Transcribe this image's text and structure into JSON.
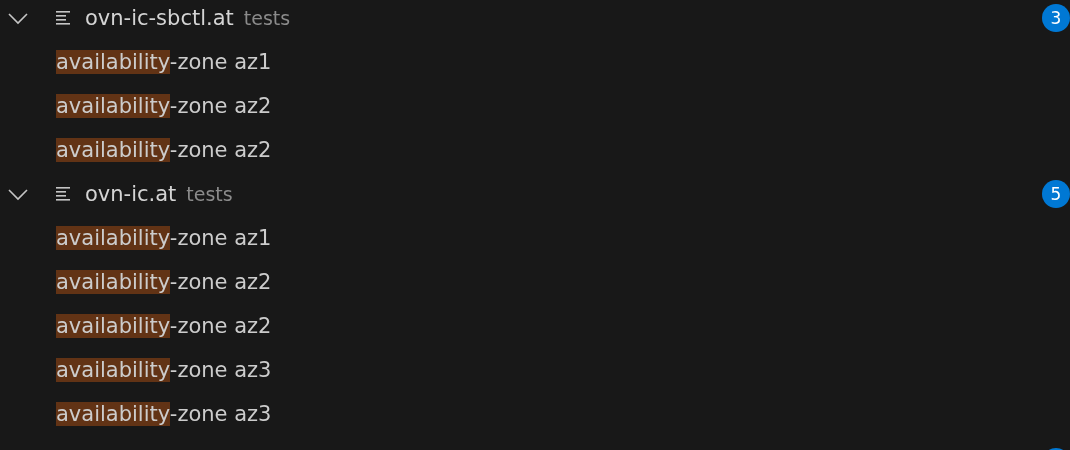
{
  "files": [
    {
      "kind": "file",
      "name": "ovn-ic-sbctl.at",
      "folder": "tests",
      "expanded": true,
      "badge": "3",
      "matches": [
        {
          "match": "availability",
          "rest": "-zone az1"
        },
        {
          "match": "availability",
          "rest": "-zone az2"
        },
        {
          "match": "availability",
          "rest": "-zone az2"
        }
      ]
    },
    {
      "kind": "file",
      "name": "ovn-ic.at",
      "folder": "tests",
      "expanded": true,
      "badge": "5",
      "matches": [
        {
          "match": "availability",
          "rest": "-zone az1"
        },
        {
          "match": "availability",
          "rest": "-zone az2"
        },
        {
          "match": "availability",
          "rest": "-zone az2"
        },
        {
          "match": "availability",
          "rest": "-zone az3"
        },
        {
          "match": "availability",
          "rest": "-zone az3"
        }
      ]
    },
    {
      "kind": "partial"
    }
  ]
}
